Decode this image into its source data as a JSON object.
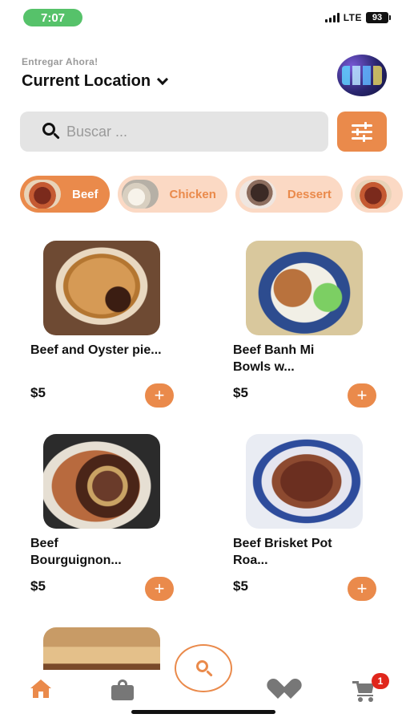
{
  "status_bar": {
    "time": "7:07",
    "network": "LTE",
    "battery": "93"
  },
  "header": {
    "deliver_label": "Entregar Ahora!",
    "location": "Current Location"
  },
  "search": {
    "placeholder": "Buscar ..."
  },
  "categories": [
    {
      "label": "Beef",
      "active": true
    },
    {
      "label": "Chicken",
      "active": false
    },
    {
      "label": "Dessert",
      "active": false
    }
  ],
  "products": [
    {
      "name": "Beef and Oyster pie...",
      "price": "$5",
      "add": "+"
    },
    {
      "name": "Beef Banh Mi Bowls w...",
      "price": "$5",
      "add": "+"
    },
    {
      "name": "Beef Bourguignon...",
      "price": "$5",
      "add": "+"
    },
    {
      "name": "Beef Brisket Pot Roa...",
      "price": "$5",
      "add": "+"
    }
  ],
  "bottom_nav": {
    "cart_badge": "1",
    "icons": [
      "home-icon",
      "bag-icon",
      "search-icon",
      "heart-icon",
      "cart-icon"
    ]
  },
  "colors": {
    "accent": "#ea8a4b",
    "chip_inactive": "#fbd9c4",
    "badge": "#e0261c"
  }
}
